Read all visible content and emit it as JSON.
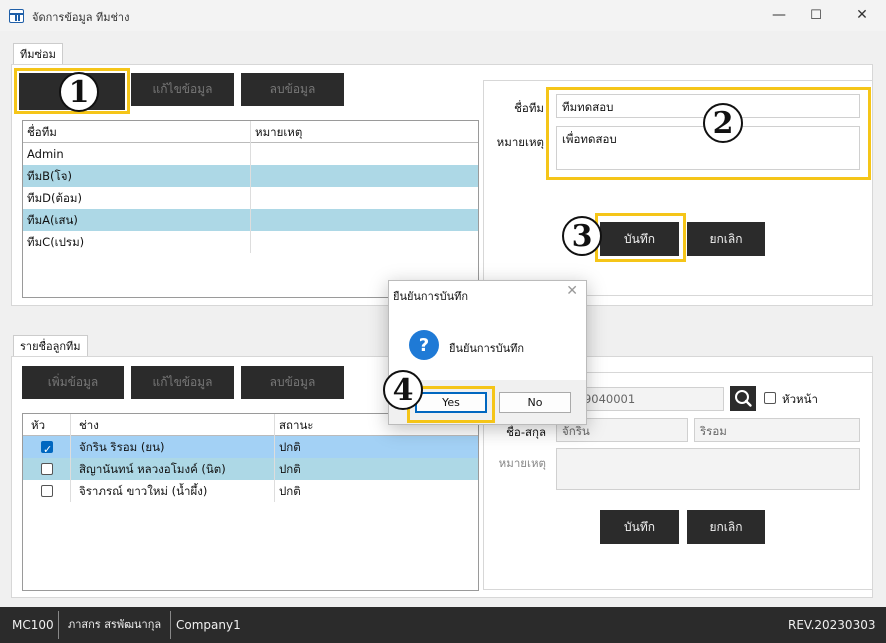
{
  "window": {
    "title": "จัดการข้อมูล ทีมช่าง",
    "minimize": "—",
    "maximize": "☐",
    "close": "✕"
  },
  "team_section": {
    "tab": "ทีมซ่อม",
    "buttons": {
      "add": "",
      "edit": "แก้ไขข้อมูล",
      "delete": "ลบข้อมูล"
    },
    "columns": [
      "ชื่อทีม",
      "หมายเหตุ"
    ],
    "rows": [
      {
        "name": "Admin",
        "note": ""
      },
      {
        "name": "ทีมB(โจ)",
        "note": ""
      },
      {
        "name": "ทีมD(ต้อม)",
        "note": ""
      },
      {
        "name": "ทีมA(เสน)",
        "note": ""
      },
      {
        "name": "ทีมC(เปรม)",
        "note": ""
      }
    ],
    "form": {
      "name_label": "ชื่อทีม",
      "name_value": "ทีมทดสอบ",
      "note_label": "หมายเหตุ",
      "note_value": "เพื่อทดสอบ",
      "save": "บันทึก",
      "cancel": "ยกเลิก"
    }
  },
  "member_section": {
    "tab": "รายชื่อลูกทีม",
    "buttons": {
      "add": "เพิ่มข้อมูล",
      "edit": "แก้ไขข้อมูล",
      "delete": "ลบข้อมูล"
    },
    "columns": [
      "หัว",
      "ช่าง",
      "สถานะ"
    ],
    "rows": [
      {
        "head": true,
        "name": "จักริน ริรอม (ยน)",
        "status": "ปกติ"
      },
      {
        "head": false,
        "name": "สิญานันทน์ หลวงอโมงค์ (นิต)",
        "status": "ปกติ"
      },
      {
        "head": false,
        "name": "จิราภรณ์ ขาวใหม่ (น้ำผึ้ง)",
        "status": "ปกติ"
      }
    ],
    "form": {
      "id_value": "0009040001",
      "head_label": "หัวหน้า",
      "fullname_label": "ชื่อ-สกุล",
      "first_name": "จักริน",
      "last_name": "ริรอม",
      "note_label": "หมายเหตุ",
      "save": "บันทึก",
      "cancel": "ยกเลิก"
    }
  },
  "dialog": {
    "title": "ยืนยันการบันทึก",
    "icon": "question-icon",
    "message": "ยืนยันการบันทึก",
    "yes": "Yes",
    "no": "No"
  },
  "annotations": {
    "n1": "1",
    "n2": "2",
    "n3": "3",
    "n4": "4"
  },
  "statusbar": {
    "machine": "MC100",
    "user": "ภาสกร สรพัฒนากุล",
    "company": "Company1",
    "revision": "REV.20230303"
  },
  "colors": {
    "highlight": "#f5c518",
    "dark_button": "#2b2b2b",
    "row_alt": "#add8e6",
    "accent": "#0067c0"
  }
}
